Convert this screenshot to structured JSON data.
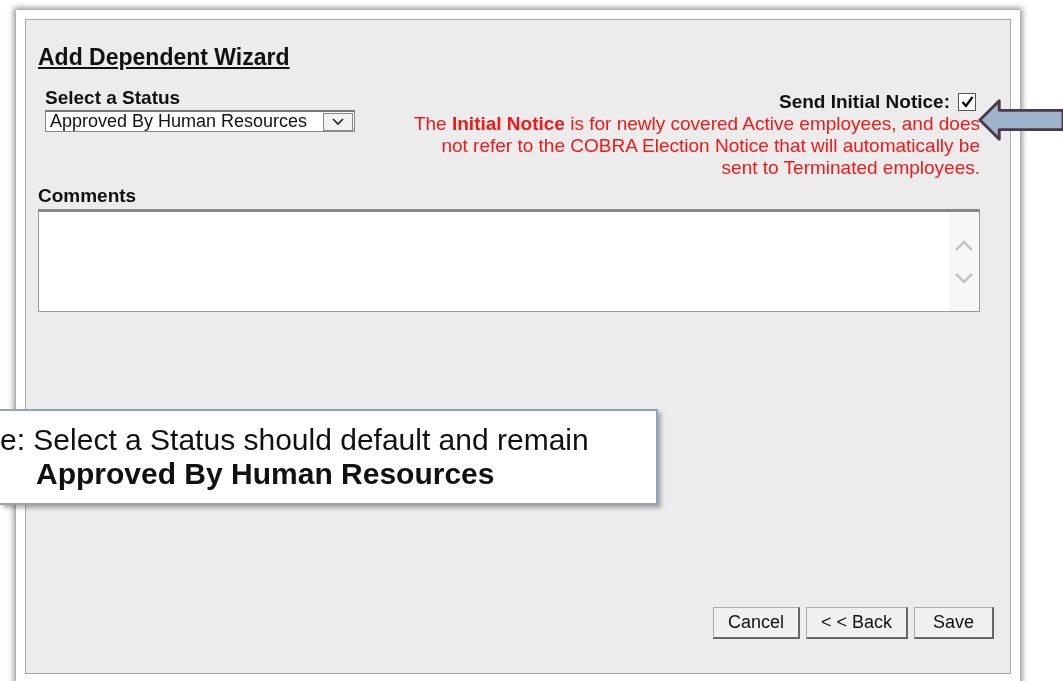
{
  "dialog": {
    "title": "Add Dependent Wizard",
    "status": {
      "label": "Select a Status",
      "value": "Approved By Human Resources"
    },
    "send_notice": {
      "label": "Send Initial Notice:",
      "checked": true
    },
    "notice_text": "The **Initial Notice** is for newly covered Active employees, and does not refer to the COBRA Election Notice that will automatically be sent to Terminated employees.",
    "comments": {
      "label": "Comments"
    },
    "buttons": [
      "Cancel",
      "< < Back",
      "Save"
    ]
  },
  "callout": {
    "lines": [
      {
        "text": "e: Select a Status should default and remain",
        "bold": false
      },
      {
        "text": "Approved By Human Resources",
        "bold": true
      }
    ]
  }
}
